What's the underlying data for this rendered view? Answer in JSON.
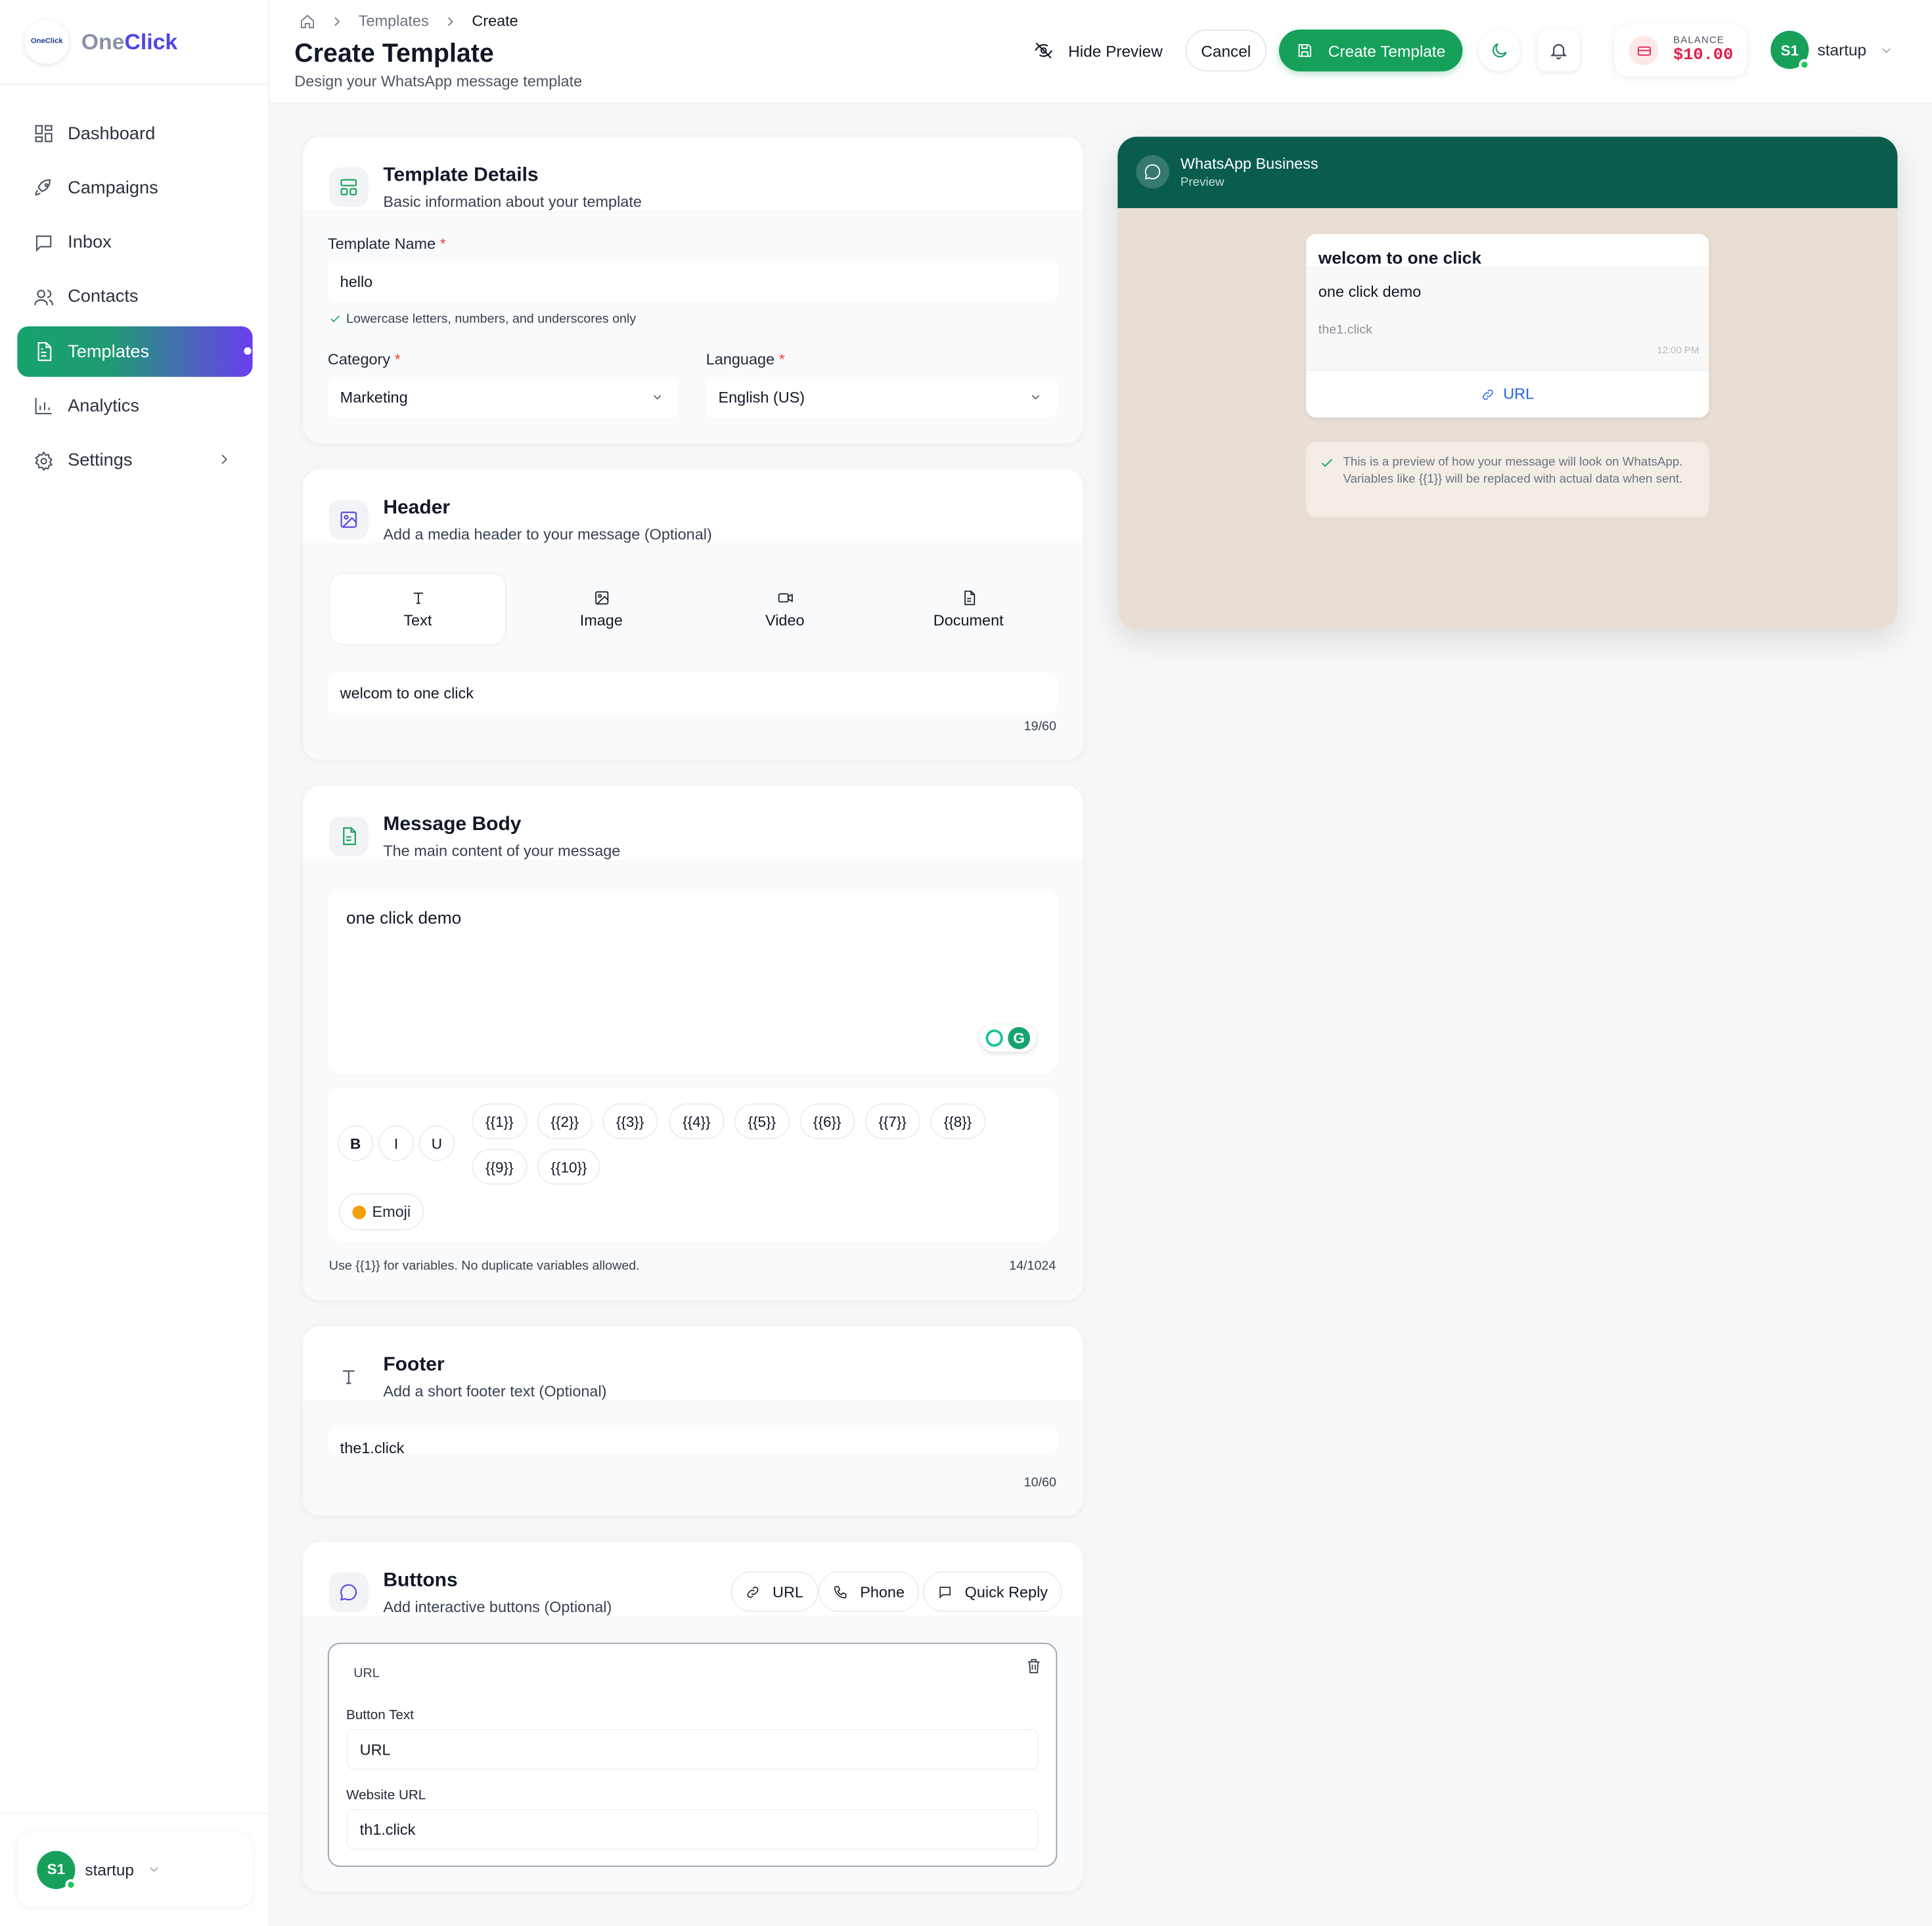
{
  "brand": {
    "logo_text": "OneClick",
    "name_prefix": "One",
    "name_accent": "Click"
  },
  "sidebar": {
    "items": [
      {
        "label": "Dashboard",
        "icon": "dashboard-icon"
      },
      {
        "label": "Campaigns",
        "icon": "rocket-icon"
      },
      {
        "label": "Inbox",
        "icon": "inbox-icon"
      },
      {
        "label": "Contacts",
        "icon": "users-icon"
      },
      {
        "label": "Templates",
        "icon": "document-icon",
        "active": true
      },
      {
        "label": "Analytics",
        "icon": "bar-chart-icon"
      },
      {
        "label": "Settings",
        "icon": "gear-icon"
      }
    ],
    "user": {
      "initials": "S1",
      "name": "startup"
    }
  },
  "breadcrumb": {
    "home_icon": "home-icon",
    "items": [
      "Templates",
      "Create"
    ]
  },
  "page": {
    "title": "Create Template",
    "subtitle": "Design your WhatsApp message template"
  },
  "header_actions": {
    "hide_preview": "Hide Preview",
    "cancel": "Cancel",
    "create": "Create Template",
    "balance_label": "BALANCE",
    "balance_value": "$10.00",
    "user_initials": "S1",
    "user_name": "startup"
  },
  "details": {
    "title": "Template Details",
    "subtitle": "Basic information about your template",
    "name_label": "Template Name",
    "name_value": "hello",
    "name_hint": "Lowercase letters, numbers, and underscores only",
    "category_label": "Category",
    "category_value": "Marketing",
    "language_label": "Language",
    "language_value": "English (US)",
    "required_mark": "*"
  },
  "header_section": {
    "title": "Header",
    "subtitle": "Add a media header to your message (Optional)",
    "tabs": [
      "Text",
      "Image",
      "Video",
      "Document"
    ],
    "selected_tab": "Text",
    "value": "welcom to one click",
    "count": "19/60"
  },
  "body": {
    "title": "Message Body",
    "subtitle": "The main content of your message",
    "value": "one click demo",
    "format": [
      "B",
      "I",
      "U"
    ],
    "variables": [
      "{{1}}",
      "{{2}}",
      "{{3}}",
      "{{4}}",
      "{{5}}",
      "{{6}}",
      "{{7}}",
      "{{8}}",
      "{{9}}",
      "{{10}}"
    ],
    "emoji_label": "Emoji",
    "hint": "Use {{1}} for variables. No duplicate variables allowed.",
    "count": "14/1024",
    "grammarly_letter": "G"
  },
  "footer": {
    "title": "Footer",
    "subtitle": "Add a short footer text (Optional)",
    "value": "the1.click",
    "count": "10/60"
  },
  "buttons": {
    "title": "Buttons",
    "subtitle": "Add interactive buttons (Optional)",
    "add": [
      "URL",
      "Phone",
      "Quick Reply"
    ],
    "item": {
      "type": "URL",
      "text_label": "Button Text",
      "text_value": "URL",
      "url_label": "Website URL",
      "url_value": "th1.click"
    }
  },
  "preview": {
    "title": "WhatsApp Business",
    "subtitle": "Preview",
    "header": "welcom to one click",
    "body": "one click demo",
    "footer": "the1.click",
    "time": "12:00 PM",
    "button": "URL",
    "note": "This is a preview of how your message will look on WhatsApp. Variables like {{1}} will be replaced with actual data when sent."
  },
  "colors": {
    "primary": "#16a05a",
    "accent": "#4f46e5",
    "whatsapp_header": "#0a5d4d",
    "danger": "#e11d48"
  }
}
